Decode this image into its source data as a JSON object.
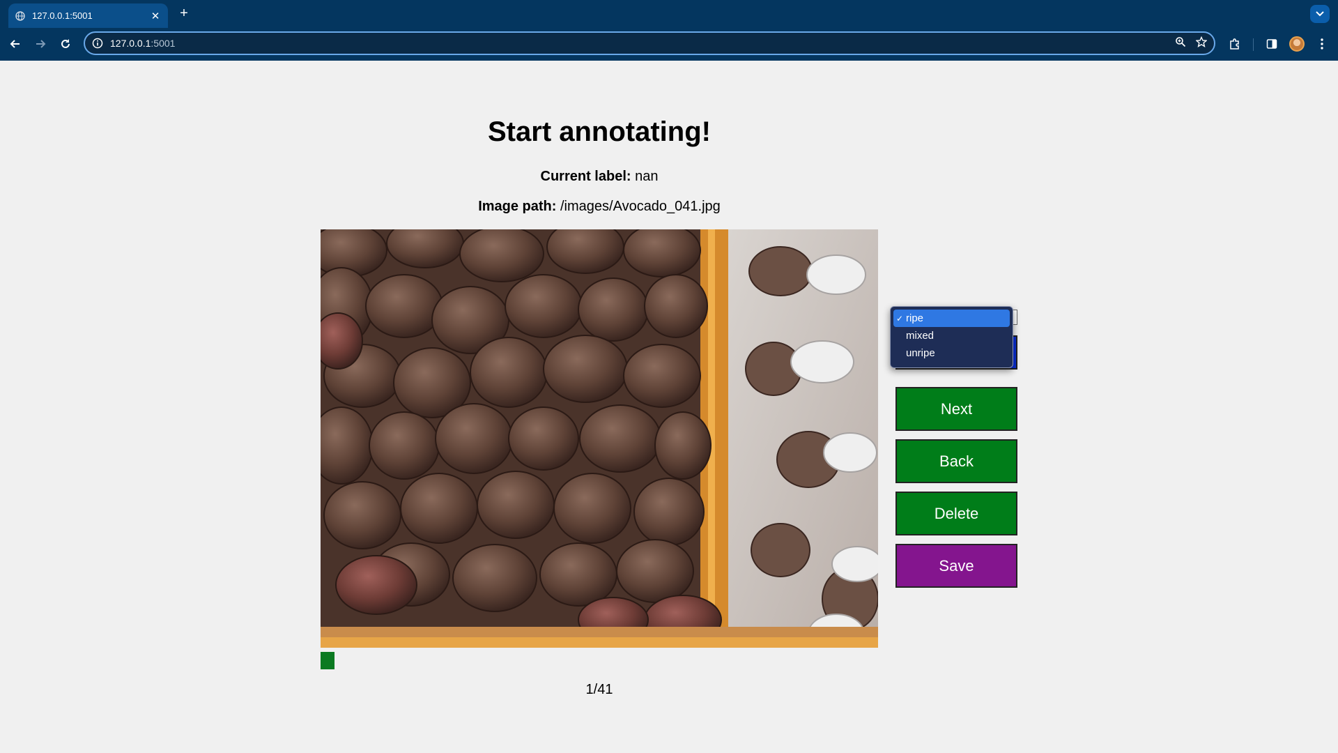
{
  "browser": {
    "tab_title": "127.0.0.1:5001",
    "url_host": "127.0.0.1",
    "url_port": ":5001"
  },
  "page": {
    "heading": "Start annotating!",
    "current_label_key": "Current label:",
    "current_label_value": "nan",
    "image_path_key": "Image path:",
    "image_path_value": "/images/Avocado_041.jpg",
    "counter": "1/41"
  },
  "dropdown": {
    "options": [
      "ripe",
      "mixed",
      "unripe"
    ],
    "selected": "ripe",
    "check_mark": "✓"
  },
  "buttons": {
    "next": "Next",
    "back": "Back",
    "delete": "Delete",
    "save": "Save"
  },
  "colors": {
    "browser_frame": "#04365f",
    "button_green": "#007d19",
    "button_purple": "#84158e",
    "button_blue": "#0a2fd6",
    "label_swatch": "#0b7a21",
    "dropdown_selected": "#2f78e3"
  }
}
